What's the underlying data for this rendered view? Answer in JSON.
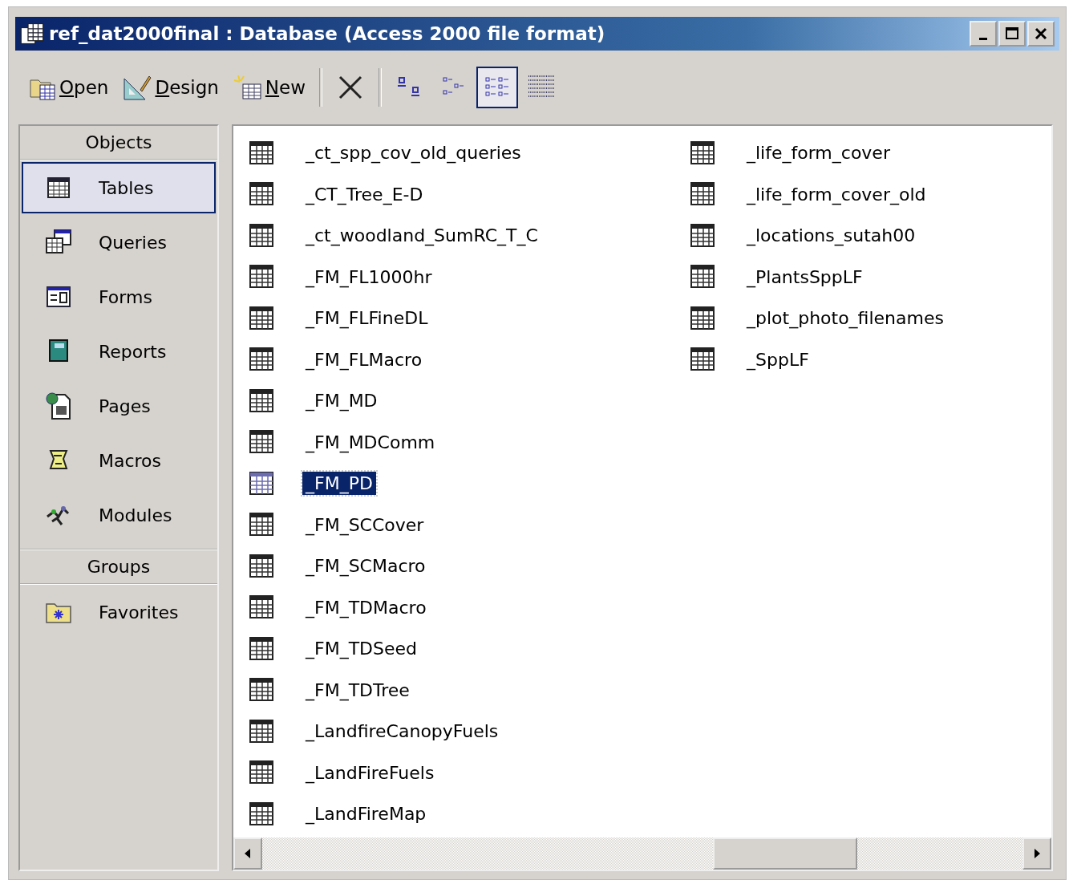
{
  "window": {
    "title": "ref_dat2000final : Database (Access 2000 file format)"
  },
  "toolbar": {
    "actions": [
      {
        "kind": "open",
        "label": "Open"
      },
      {
        "kind": "design",
        "label": "Design"
      },
      {
        "kind": "new",
        "label": "New"
      }
    ],
    "views": [
      {
        "kind": "large",
        "selected": false
      },
      {
        "kind": "small",
        "selected": false
      },
      {
        "kind": "list",
        "selected": true
      },
      {
        "kind": "details",
        "selected": false
      }
    ]
  },
  "sidebar": {
    "objects_header": "Objects",
    "items": [
      {
        "kind": "tables",
        "label": "Tables",
        "selected": true
      },
      {
        "kind": "queries",
        "label": "Queries",
        "selected": false
      },
      {
        "kind": "forms",
        "label": "Forms",
        "selected": false
      },
      {
        "kind": "reports",
        "label": "Reports",
        "selected": false
      },
      {
        "kind": "pages",
        "label": "Pages",
        "selected": false
      },
      {
        "kind": "macros",
        "label": "Macros",
        "selected": false
      },
      {
        "kind": "modules",
        "label": "Modules",
        "selected": false
      }
    ],
    "groups_header": "Groups",
    "groups": [
      {
        "kind": "favorites",
        "label": "Favorites",
        "selected": false
      }
    ]
  },
  "list": {
    "columns": [
      [
        {
          "label": "_ct_spp_cov_old_queries",
          "selected": false
        },
        {
          "label": "_CT_Tree_E-D",
          "selected": false
        },
        {
          "label": "_ct_woodland_SumRC_T_C",
          "selected": false
        },
        {
          "label": "_FM_FL1000hr",
          "selected": false
        },
        {
          "label": "_FM_FLFineDL",
          "selected": false
        },
        {
          "label": "_FM_FLMacro",
          "selected": false
        },
        {
          "label": "_FM_MD",
          "selected": false
        },
        {
          "label": "_FM_MDComm",
          "selected": false
        },
        {
          "label": "_FM_PD",
          "selected": true
        },
        {
          "label": "_FM_SCCover",
          "selected": false
        },
        {
          "label": "_FM_SCMacro",
          "selected": false
        },
        {
          "label": "_FM_TDMacro",
          "selected": false
        },
        {
          "label": "_FM_TDSeed",
          "selected": false
        },
        {
          "label": "_FM_TDTree",
          "selected": false
        },
        {
          "label": "_LandfireCanopyFuels",
          "selected": false
        },
        {
          "label": "_LandFireFuels",
          "selected": false
        },
        {
          "label": "_LandFireMap",
          "selected": false
        }
      ],
      [
        {
          "label": "_life_form_cover",
          "selected": false
        },
        {
          "label": "_life_form_cover_old",
          "selected": false
        },
        {
          "label": "_locations_sutah00",
          "selected": false
        },
        {
          "label": "_PlantsSppLF",
          "selected": false
        },
        {
          "label": "_plot_photo_filenames",
          "selected": false
        },
        {
          "label": "_SppLF",
          "selected": false
        }
      ]
    ]
  }
}
